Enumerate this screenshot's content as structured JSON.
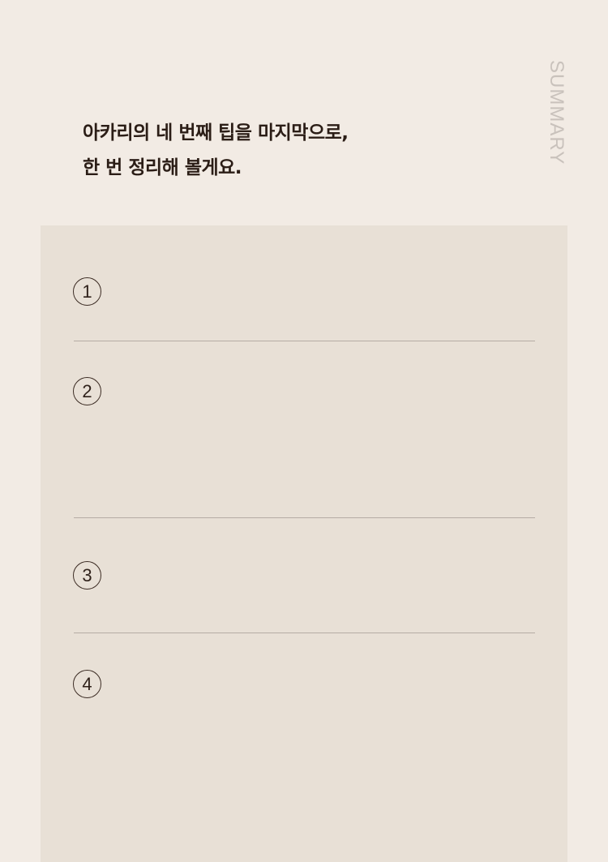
{
  "intro": {
    "line1": "아카리의 네 번째 팁을 마지막으로,",
    "line2": "한 번 정리해 볼게요."
  },
  "side_label": "SUMMARY",
  "summary": {
    "items": [
      {
        "number": "1"
      },
      {
        "number": "2"
      },
      {
        "number": "3"
      },
      {
        "number": "4"
      }
    ]
  }
}
